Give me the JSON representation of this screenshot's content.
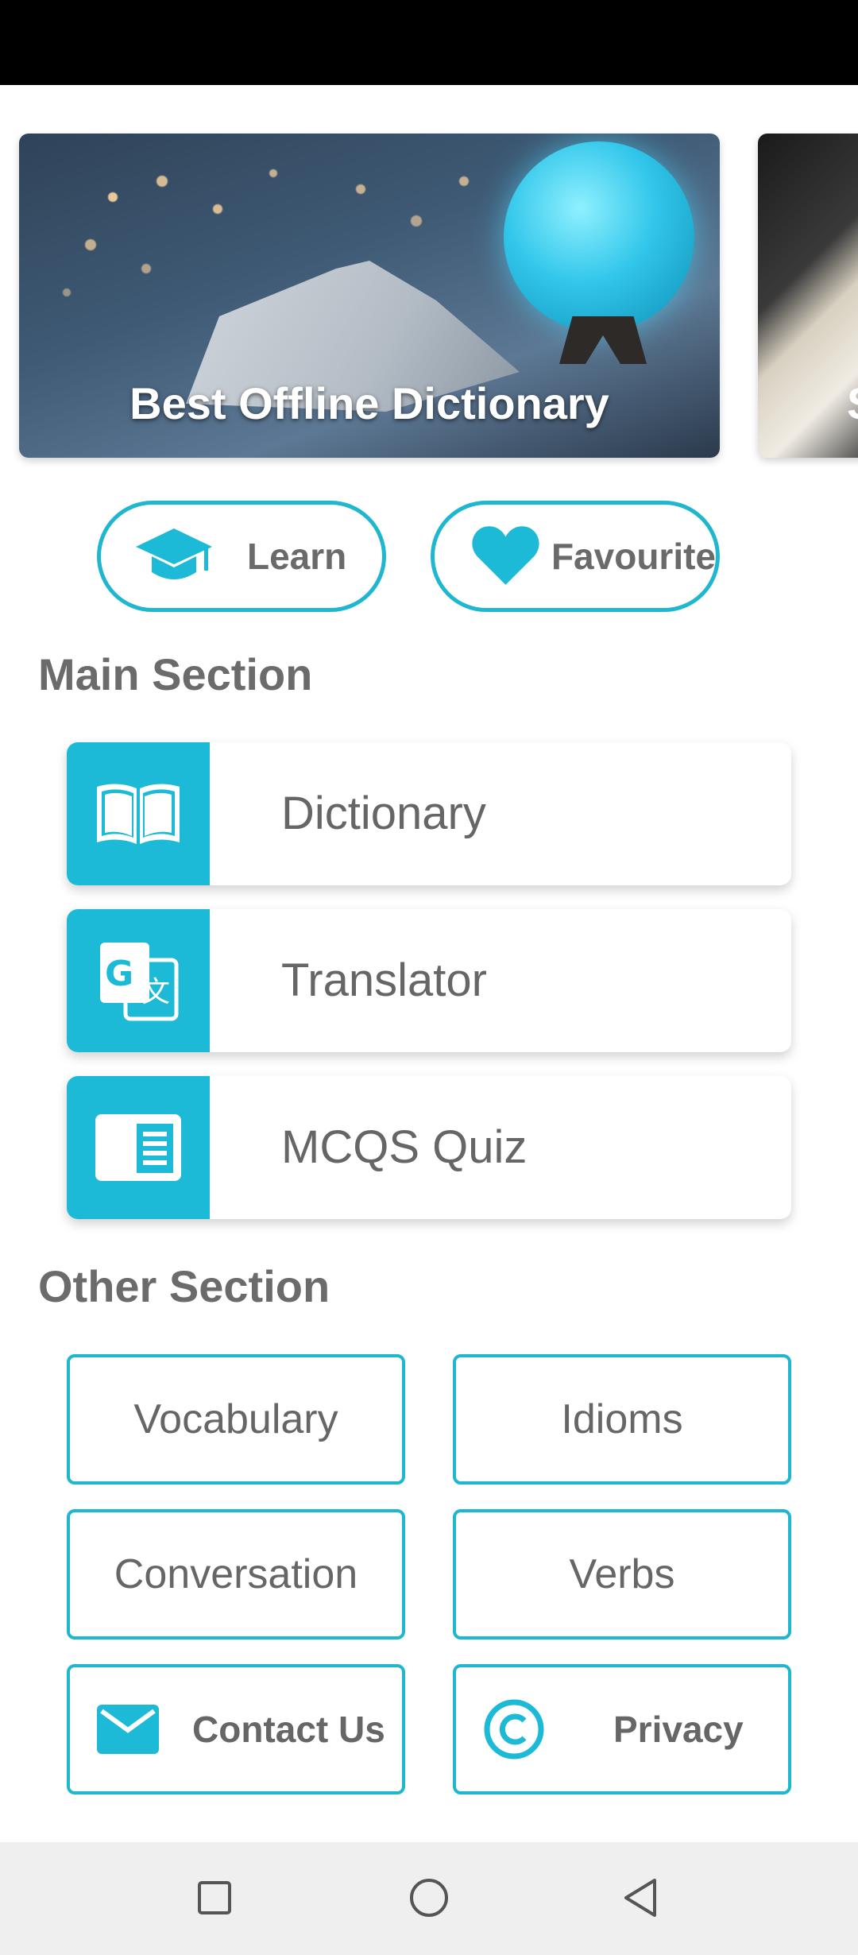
{
  "banner": {
    "caption": "Best Offline Dictionary",
    "next_caption": "S"
  },
  "quick_actions": {
    "learn_label": "Learn",
    "favourite_label": "Favourite"
  },
  "main_section": {
    "title": "Main Section",
    "items": [
      {
        "label": "Dictionary",
        "icon": "open-book-icon"
      },
      {
        "label": "Translator",
        "icon": "translate-icon"
      },
      {
        "label": "MCQS Quiz",
        "icon": "quiz-list-icon"
      }
    ]
  },
  "other_section": {
    "title": "Other Section",
    "items": [
      {
        "label": "Vocabulary"
      },
      {
        "label": "Idioms"
      },
      {
        "label": "Conversation"
      },
      {
        "label": "Verbs"
      },
      {
        "label": "Contact Us",
        "icon": "mail-icon"
      },
      {
        "label": "Privacy",
        "icon": "copyright-icon"
      }
    ]
  },
  "colors": {
    "accent": "#1cbad6",
    "text": "#666666",
    "status_bar": "#000000",
    "nav_bar": "#efefef"
  }
}
